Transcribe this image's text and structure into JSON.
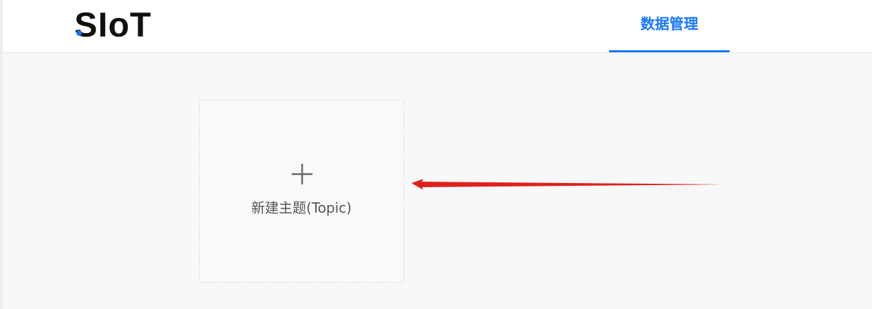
{
  "header": {
    "logo": {
      "text": "SIoT",
      "accent_color": "#1a73e8"
    },
    "nav": {
      "active_tab_label": "数据管理",
      "active_color": "#1677ff"
    }
  },
  "main": {
    "new_topic_card": {
      "icon": "plus-icon",
      "label": "新建主题(Topic)"
    }
  },
  "annotation": {
    "arrow_color": "#e0201c"
  }
}
